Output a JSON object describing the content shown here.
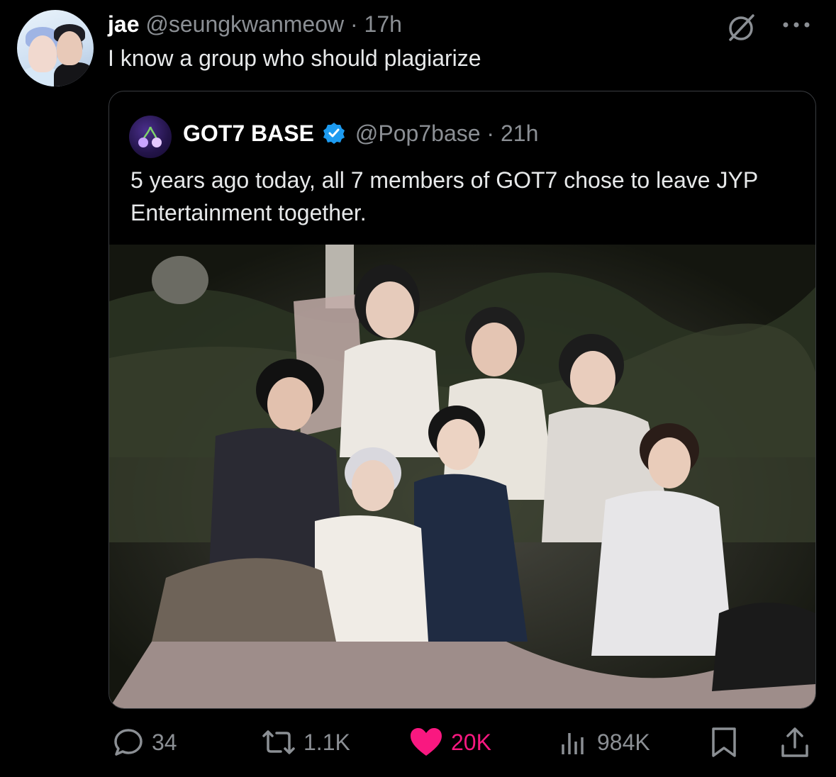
{
  "post": {
    "author_name": "jae",
    "author_handle": "@seungkwanmeow",
    "separator": "·",
    "time": "17h",
    "text": "I know a group who should plagiarize"
  },
  "quoted": {
    "author_name": "GOT7 BASE",
    "author_handle": "@Pop7base",
    "separator": "·",
    "time": "21h",
    "text": "5 years ago today, all 7 members of GOT7 chose to leave JYP Entertainment together."
  },
  "actions": {
    "replies": "34",
    "reposts": "1.1K",
    "likes": "20K",
    "views": "984K"
  },
  "colors": {
    "background": "#000000",
    "text": "#e7e9ea",
    "muted": "#8b8f94",
    "like": "#f91880",
    "verified": "#1d9bf0",
    "border": "#3a3d41"
  },
  "icons": [
    "grok-icon",
    "more-icon",
    "verified-badge-icon",
    "reply-icon",
    "repost-icon",
    "like-icon",
    "views-icon",
    "bookmark-icon",
    "share-icon"
  ]
}
